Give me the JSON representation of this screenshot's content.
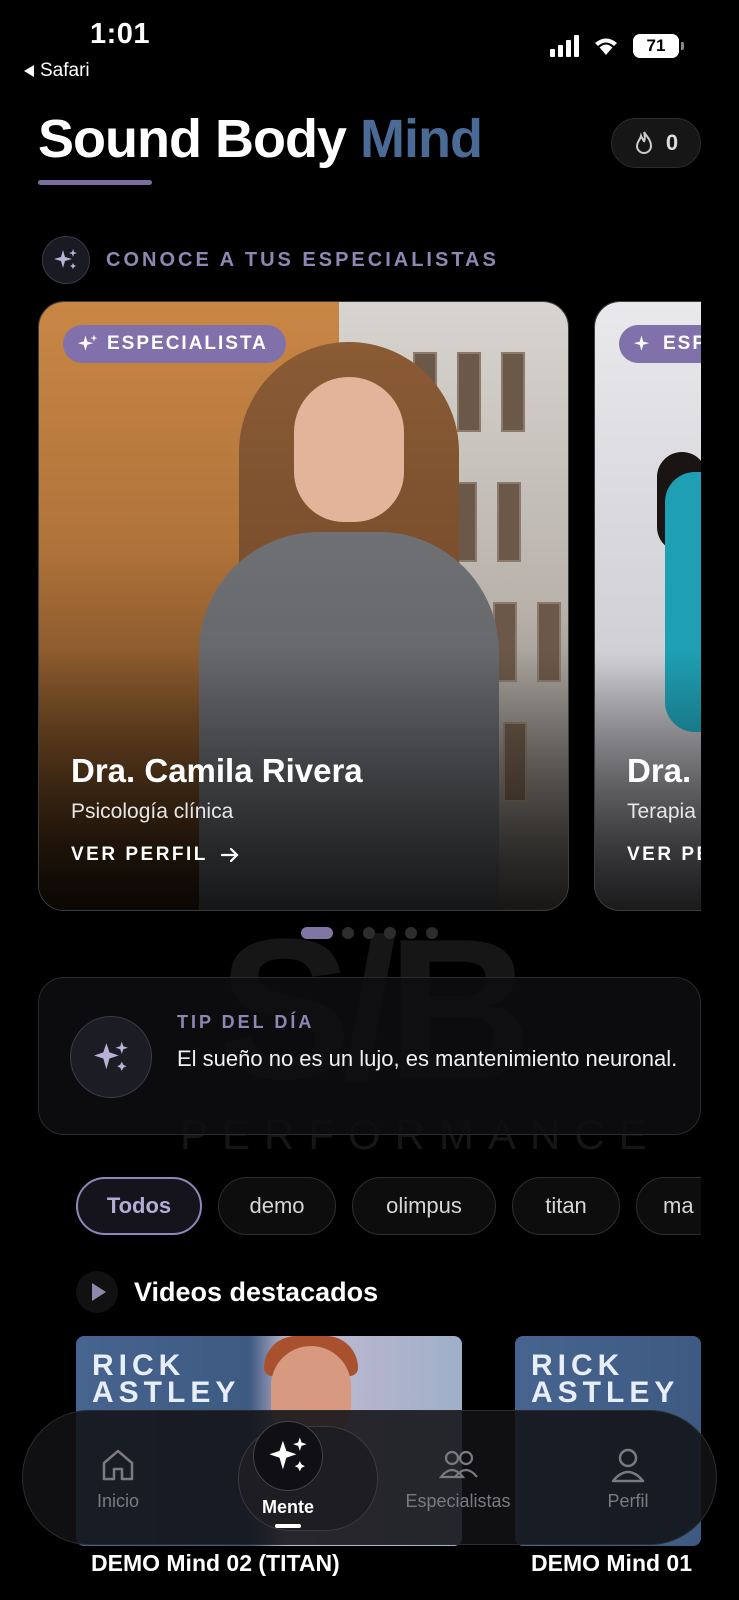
{
  "status_bar": {
    "time": "1:01",
    "back_app": "Safari",
    "battery": "71"
  },
  "header": {
    "title_main": "Sound Body",
    "title_accent": "Mind",
    "streak_count": "0"
  },
  "specialists_section": {
    "heading": "CONOCE A TUS ESPECIALISTAS",
    "cards": [
      {
        "chip": "ESPECIALISTA",
        "name": "Dra. Camila Rivera",
        "role": "Psicología clínica",
        "link": "VER PERFIL"
      },
      {
        "chip": "ESPECIALISTA",
        "name": "Dra.",
        "role": "Terapia",
        "link": "VER PERFIL"
      }
    ]
  },
  "tip": {
    "label": "TIP DEL DÍA",
    "text": "El sueño no es un lujo, es mantenimiento neuronal."
  },
  "filters": [
    "Todos",
    "demo",
    "olimpus",
    "titan",
    "ma"
  ],
  "videos": {
    "heading": "Videos destacados",
    "items": [
      {
        "thumb_text": "RICK ASTLEY",
        "title": "DEMO Mind 02 (TITAN)"
      },
      {
        "thumb_text": "RICK ASTLEY",
        "title": "DEMO Mind 01"
      }
    ]
  },
  "nav": {
    "home": "Inicio",
    "mente": "Mente",
    "especialistas": "Especialistas",
    "perfil": "Perfil"
  },
  "colors": {
    "accent": "#4b6b97",
    "lavender": "#8071ab",
    "background": "#000000"
  }
}
